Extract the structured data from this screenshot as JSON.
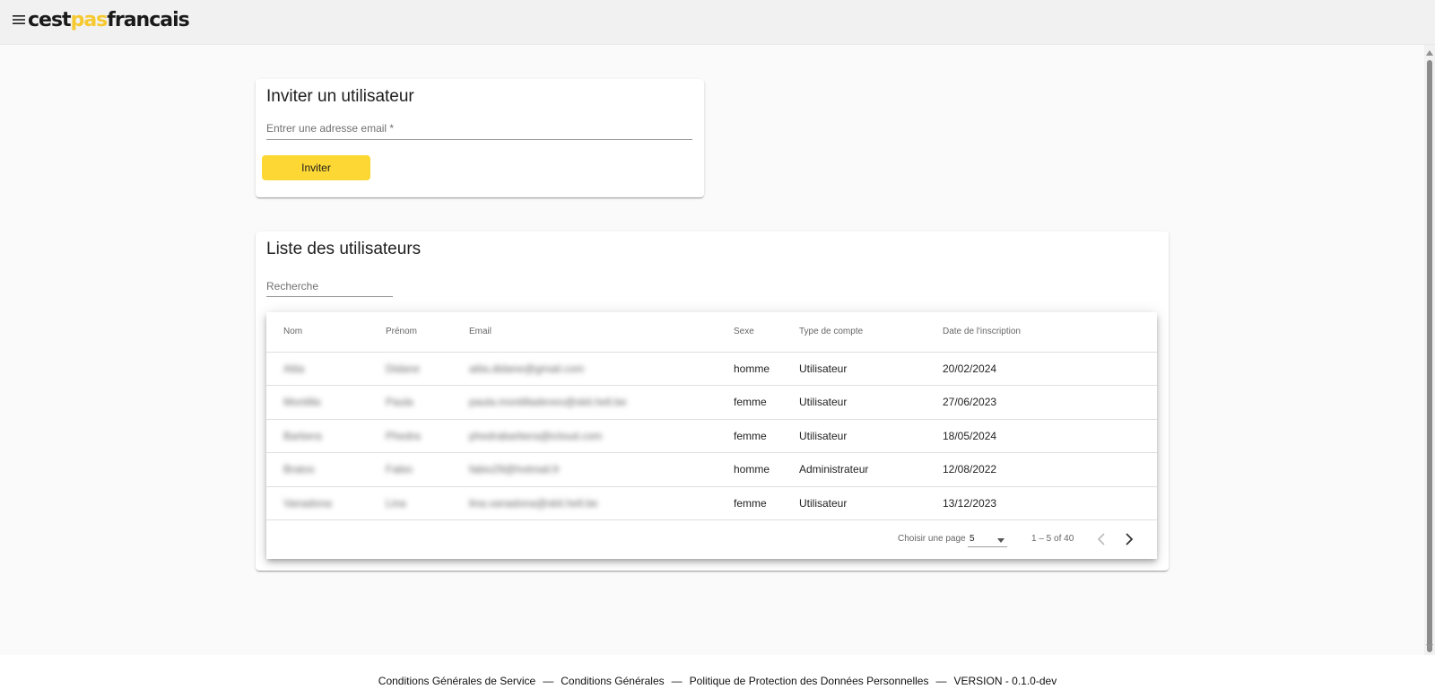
{
  "header": {
    "logo_part1": "cest",
    "logo_part2": "pas",
    "logo_part3": "francais",
    "brand_color": "#fdd835"
  },
  "invite": {
    "title": "Inviter un utilisateur",
    "email_placeholder": "Entrer une adresse email *",
    "email_value": "",
    "button_label": "Inviter"
  },
  "users": {
    "title": "Liste des utilisateurs",
    "search_placeholder": "Recherche",
    "columns": [
      "Nom",
      "Prénom",
      "Email",
      "Sexe",
      "Type de compte",
      "Date de l'inscription"
    ],
    "rows": [
      {
        "nom": "Aitia",
        "prenom": "Didane",
        "email": "aitia.didane@gmail.com",
        "sexe": "homme",
        "type": "Utilisateur",
        "date": "20/02/2024"
      },
      {
        "nom": "Montilla",
        "prenom": "Paula",
        "email": "paula.montilladeveo@skit.hell.be",
        "sexe": "femme",
        "type": "Utilisateur",
        "date": "27/06/2023"
      },
      {
        "nom": "Barbera",
        "prenom": "Phedra",
        "email": "phedrabarbera@icloud.com",
        "sexe": "femme",
        "type": "Utilisateur",
        "date": "18/05/2024"
      },
      {
        "nom": "Bratos",
        "prenom": "Fabio",
        "email": "fabio29@hotmail.fr",
        "sexe": "homme",
        "type": "Administrateur",
        "date": "12/08/2022"
      },
      {
        "nom": "Vanadona",
        "prenom": "Lina",
        "email": "lina.vanadona@skit.hell.be",
        "sexe": "femme",
        "type": "Utilisateur",
        "date": "13/12/2023"
      }
    ],
    "paginator": {
      "label": "Choisir une page",
      "page_size": "5",
      "range": "1 – 5 of 40"
    }
  },
  "footer": {
    "link1": "Conditions Générales de Service",
    "link2": "Conditions Générales",
    "link3": "Politique de Protection des Données Personnelles",
    "version": "VERSION - 0.1.0-dev",
    "separator": "—"
  }
}
